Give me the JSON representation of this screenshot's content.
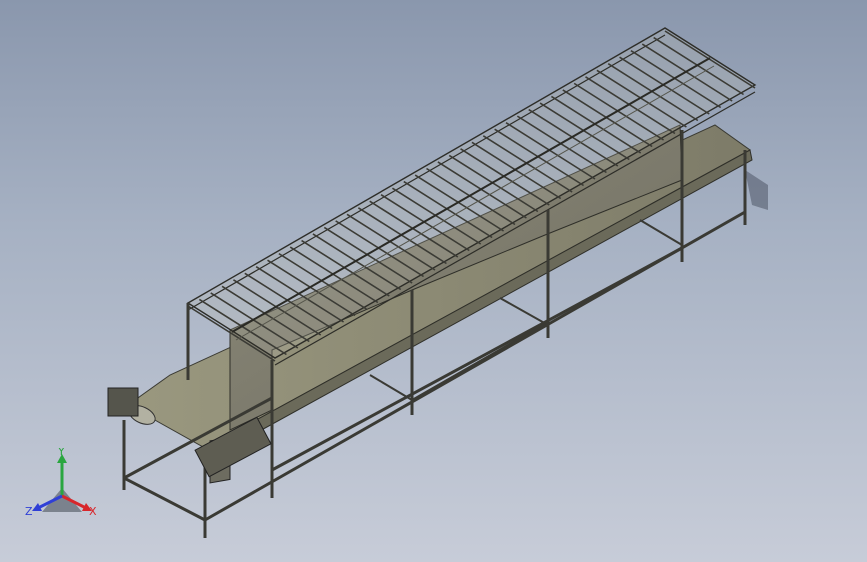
{
  "view": {
    "background_top": "#8a97ad",
    "background_bottom": "#c7ccd8",
    "model": "conveyor-line-assembly"
  },
  "triad": {
    "x_label": "X",
    "y_label": "Y",
    "z_label": "Z",
    "x_color": "#d8262b",
    "y_color": "#2aa640",
    "z_color": "#2f3fd6"
  }
}
